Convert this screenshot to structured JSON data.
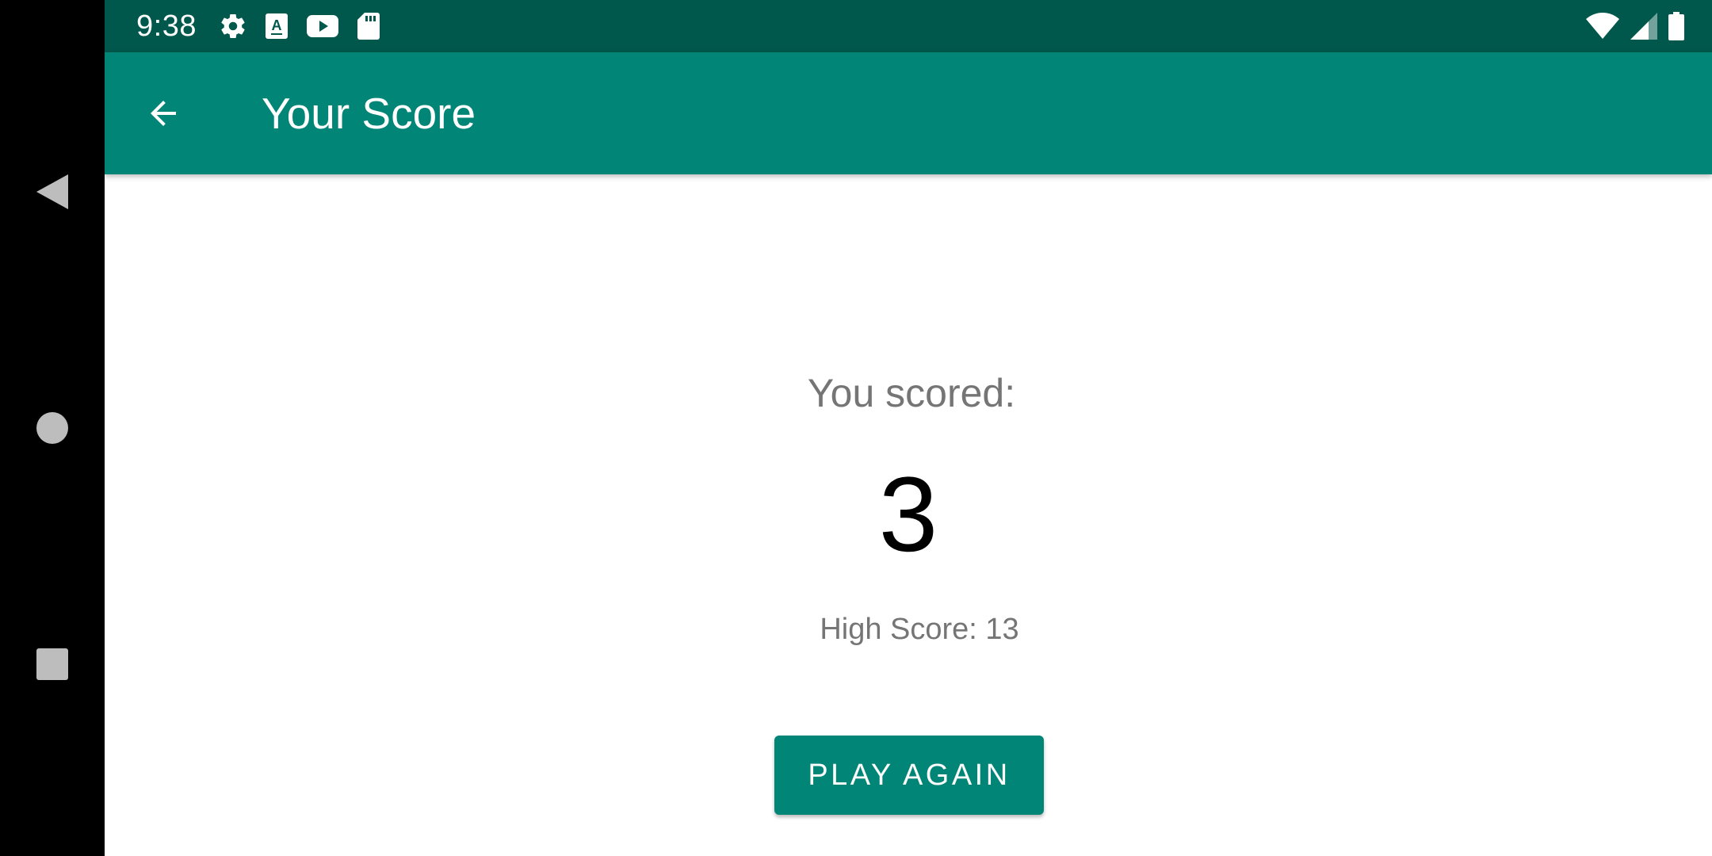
{
  "status_bar": {
    "time": "9:38",
    "icons_left": [
      "settings-icon",
      "font-a-icon",
      "youtube-icon",
      "sd-card-icon"
    ],
    "icons_right": [
      "wifi-icon",
      "cell-signal-icon",
      "battery-icon"
    ],
    "background": "#00574b"
  },
  "app_bar": {
    "title": "Your Score",
    "back_icon": "arrow-back-icon",
    "background": "#008577"
  },
  "score": {
    "label": "You scored:",
    "value": "3",
    "high_score_text": "High Score: 13"
  },
  "actions": {
    "play_again_label": "PLAY AGAIN",
    "accent": "#008577"
  },
  "nav_bar": {
    "buttons": [
      "back-triangle-icon",
      "home-circle-icon",
      "recents-square-icon"
    ]
  }
}
